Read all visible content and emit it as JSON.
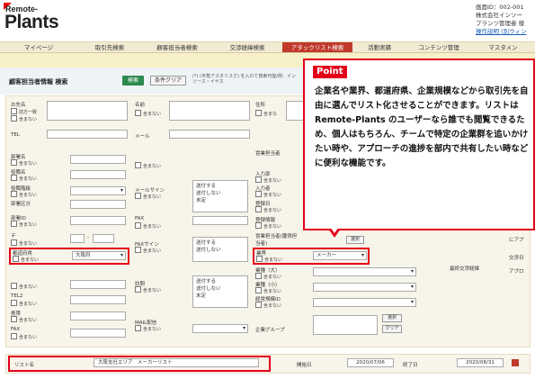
{
  "header": {
    "logo_top": "Remote-",
    "logo_main": "Plants",
    "screen_id": "画面ID：002-001",
    "company": "株式会社インソー",
    "user": "プランツ管理者 様",
    "link": "操作説明 (別ウィン"
  },
  "nav": {
    "tabs": [
      {
        "label": "マイページ",
        "w": 86
      },
      {
        "label": "取引先検索",
        "w": 72
      },
      {
        "label": "顧客担当者検索",
        "w": 78
      },
      {
        "label": "交渉経緯検索",
        "w": 78
      },
      {
        "label": "アタックリスト検索",
        "w": 78,
        "active": true
      },
      {
        "label": "活動実績",
        "w": 60
      },
      {
        "label": "コンテンツ管理",
        "w": 72
      },
      {
        "label": "マスタメン",
        "w": 71
      }
    ]
  },
  "section": {
    "title": "顧客担当者情報 検索",
    "search_btn": "検索",
    "clear_btn": "条件クリア",
    "note": "(*) (半角アスタリスク) を入れて検索可能/例：インソース・イヤス"
  },
  "form": {
    "company_name": "お先名",
    "company_chk1": "前方一致",
    "company_chk2": "含まない",
    "name": "名前",
    "name_chk": "含まない",
    "address": "住所",
    "address_chk": "含まな",
    "tel": "TEL",
    "mail": "メール",
    "dept": "部署名",
    "title": "役職名",
    "rank": "役職階級",
    "dept_class": "部署区分",
    "dept_id": "部署ID",
    "postal": "〒",
    "pref": "都道府県",
    "pref_value": "大阪府",
    "tel2": "TEL2",
    "mobile": "携帯",
    "fax_label": "FAX",
    "mail_sign": "メールサイン",
    "fax_sign": "FAXサイン",
    "visit": "訪問",
    "mail_dist": "MAIL配信",
    "group": "企業グループ",
    "biz_owner": "営業担当者",
    "intro_dept": "入力部",
    "intro_user": "入力者",
    "reg_date": "登録日",
    "reg_info": "登録情報",
    "biz_owner2": "営業担当者(獲得担当者)",
    "industry": "業界",
    "industry_value": "メーカー",
    "scale_l": "業種（大）",
    "scale_s": "業種（小）",
    "scale_id": "経営規模ID",
    "last_neg": "最終交渉経緯",
    "negotiation": "交渉日",
    "apply": "アプロ",
    "sd": "にアプ",
    "not": "含まない",
    "opt1": "送付する",
    "opt2": "送付しない",
    "opt3": "未定",
    "select_btn": "選択",
    "clear_small": "クリア"
  },
  "bottom": {
    "list_name_label": "リスト名",
    "list_name_value": "大阪支社エリア　メーカーリスト",
    "start_label": "開始日",
    "start_value": "2020/07/06",
    "end_label": "終了日",
    "end_value": "2020/08/31"
  },
  "point": {
    "tag": "Point",
    "text": "企業名や業界、都道府県、企業規模などから取引先を自由に選んでリスト化させることができます。リストは Remote-Plants のユーザーなら誰でも閲覧できるため、個人はもちろん、チームで特定の企業群を追いかけたい時や、アプローチの進捗を部内で共有したい時などに便利な機能です。"
  },
  "colors": {
    "accent": "#e3001b",
    "nav_bg": "#f3ead4",
    "active_tab": "#c0392b",
    "search_btn": "#2d8a4e"
  }
}
